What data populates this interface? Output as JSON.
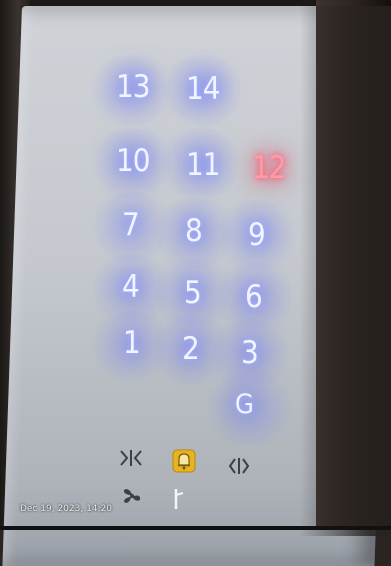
{
  "buttons": {
    "b13": "13",
    "b14": "14",
    "b10": "10",
    "b11": "11",
    "b12": "12",
    "b7": "7",
    "b8": "8",
    "b9": "9",
    "b4": "4",
    "b5": "5",
    "b6": "6",
    "b1": "1",
    "b2": "2",
    "b3": "3",
    "bG": "G"
  },
  "controls": {
    "close_door": "close-door-icon",
    "alarm": "alarm-bell-icon",
    "open_door": "open-door-icon",
    "fan": "fan-icon",
    "light": "light-icon"
  },
  "colors": {
    "lit_blue": "#a9b4ff",
    "lit_red": "#ff3050",
    "alarm_yellow": "#e6b422"
  },
  "timestamp": "Dec 19, 2023, 14:20"
}
